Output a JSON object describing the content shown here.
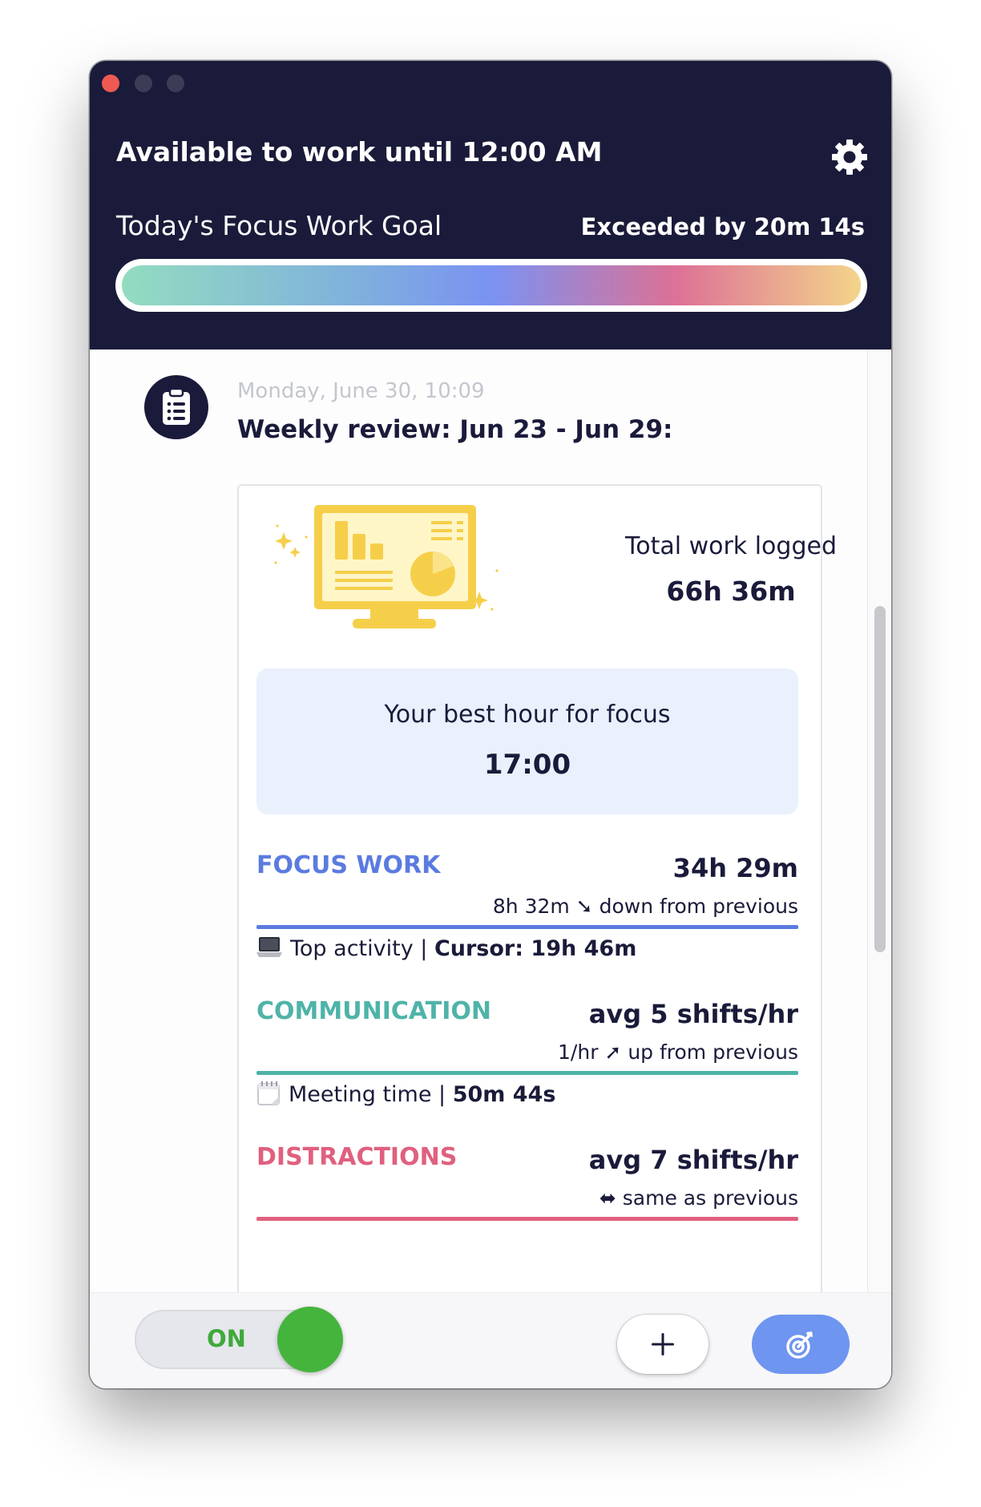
{
  "header": {
    "availability": "Available to work until 12:00 AM",
    "goal_label": "Today's Focus Work Goal",
    "goal_status": "Exceeded by 20m 14s",
    "goal_progress": 1.0
  },
  "message": {
    "date": "Monday, June 30, 10:09",
    "title": "Weekly review: Jun 23 - Jun 29:"
  },
  "summary": {
    "total_label": "Total work logged",
    "total_value": "66h 36m",
    "best_label": "Your best hour for focus",
    "best_value": "17:00"
  },
  "sections": {
    "focus": {
      "title": "FOCUS WORK",
      "value": "34h 29m",
      "trend": "8h 32m ➘ down from previous",
      "detail_label": "Top activity | ",
      "detail_value": "Cursor: 19h 46m",
      "color": "#5b7be0"
    },
    "communication": {
      "title": "COMMUNICATION",
      "value": "avg 5 shifts/hr",
      "trend": "1/hr ➚ up from previous",
      "detail_label": "Meeting time | ",
      "detail_value": "50m 44s",
      "color": "#4fb3a8"
    },
    "distractions": {
      "title": "DISTRACTIONS",
      "value": "avg 7 shifts/hr",
      "trend": "⬌ same as previous",
      "color": "#e0607e"
    }
  },
  "footer": {
    "toggle_label": "ON"
  },
  "icons": {
    "settings": "gear-icon",
    "avatar": "clipboard-icon",
    "add": "plus-icon",
    "focus": "target-arrow-icon",
    "focus_detail": "laptop-icon",
    "communication_detail": "calendar-icon"
  }
}
